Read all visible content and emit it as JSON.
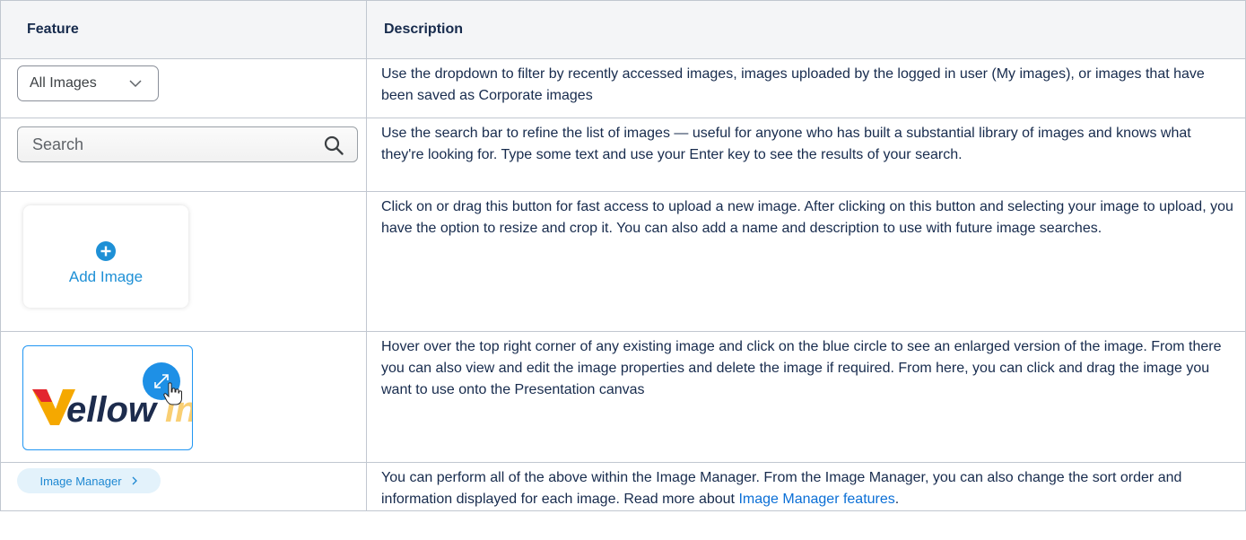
{
  "headers": {
    "feature": "Feature",
    "description": "Description"
  },
  "rows": [
    {
      "control": {
        "label": "All Images",
        "icon": "chevron-down-icon"
      },
      "description": "Use the dropdown to filter by recently accessed images, images uploaded by the logged in user (My images), or images that have been saved as Corporate images"
    },
    {
      "control": {
        "placeholder": "Search",
        "icon": "search-icon"
      },
      "description": "Use the search bar to refine the list of images — useful for anyone who has built a substantial library of images and knows what they're looking for. Type some text and use your Enter key to see the results of your search."
    },
    {
      "control": {
        "label": "Add Image",
        "icon": "plus-circle-icon"
      },
      "description": "Click on or drag this button for fast access to upload a new image. After clicking on this button and selecting your image to upload, you have the option to resize and crop it. You can also add a name and description to use with future image searches."
    },
    {
      "control": {
        "logo_text": "Yellowfin",
        "icon": "expand-icon"
      },
      "description": "Hover over the top right corner of any existing image and click on the blue circle to see an enlarged version of the image. From there you can also view and edit the image properties and delete the image if required. From here, you can click and drag the image you want to use onto the Presentation canvas"
    },
    {
      "control": {
        "label": "Image Manager",
        "icon": "chevron-right-icon"
      },
      "description_prefix": "You can perform all of the above within the Image Manager. From the Image Manager, you can also change the sort order and information displayed for each image. Read more about ",
      "link_text": "Image Manager features",
      "description_suffix": "."
    }
  ],
  "colors": {
    "accent": "#1e90d6",
    "link": "#0b6fd6",
    "header_bg": "#f4f5f7",
    "border": "#c1c7d0"
  }
}
